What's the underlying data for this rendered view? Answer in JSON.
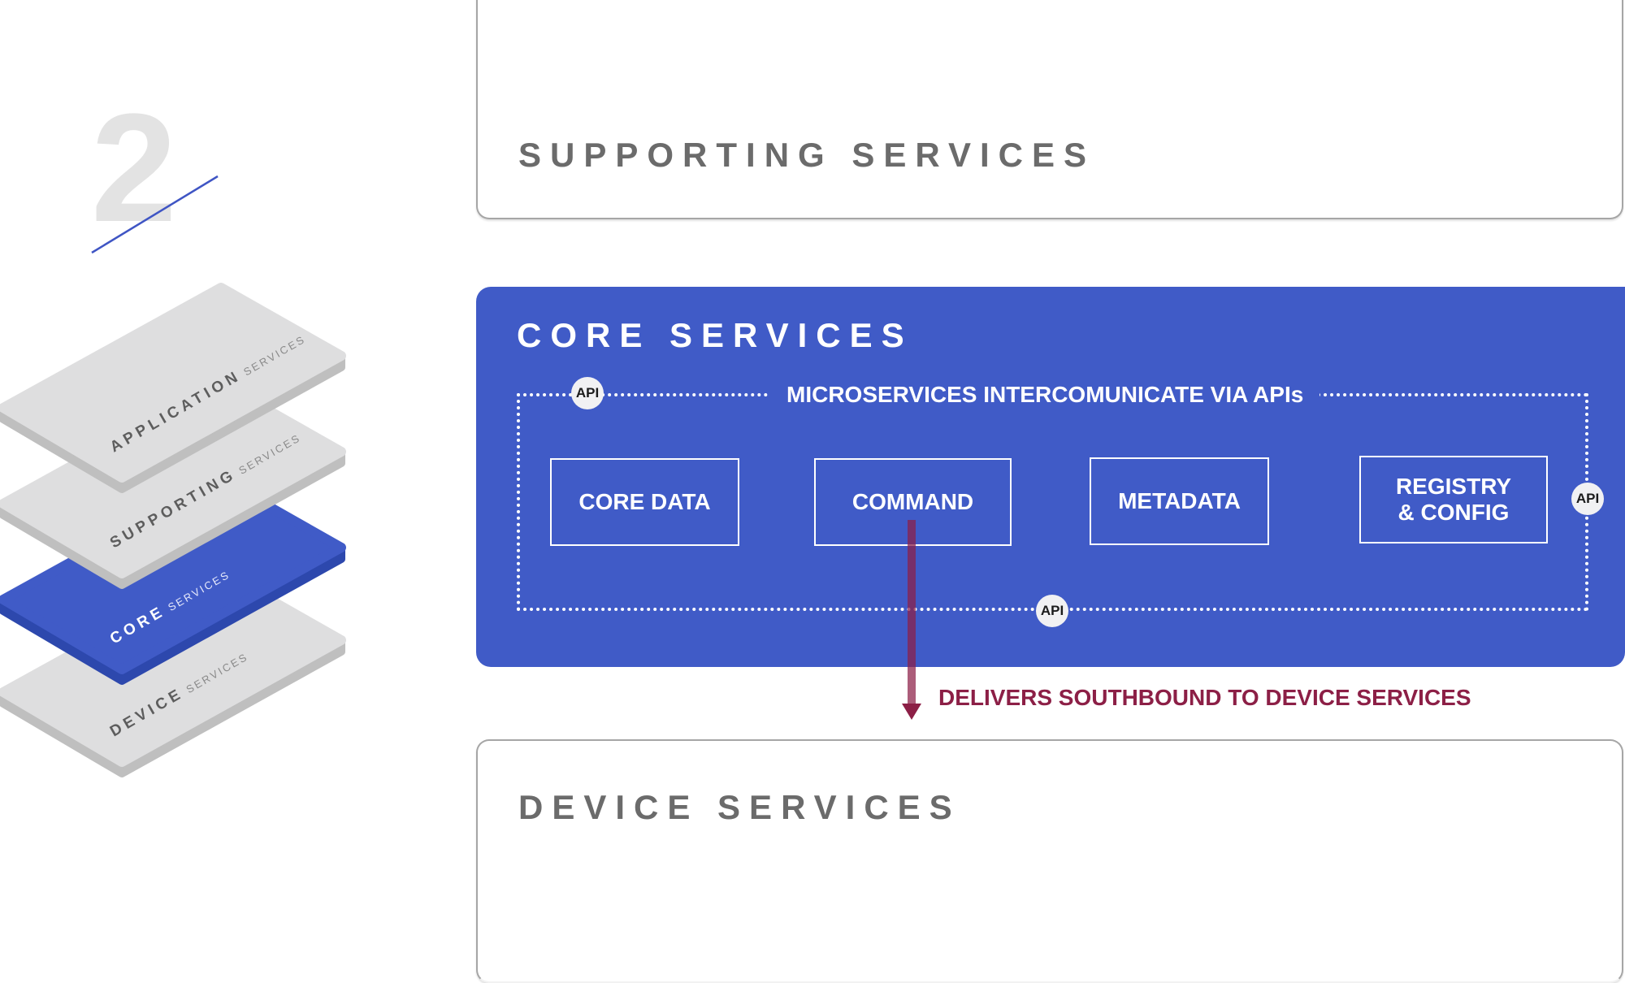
{
  "step": {
    "number": "2"
  },
  "colors": {
    "core_blue": "#405bc7",
    "core_blue_dark": "#2d48ad",
    "card_gray": "#dededf",
    "card_edge": "#bfbfbf",
    "title_gray": "#6b6b6b",
    "accent_maroon": "#8c1f46",
    "step_line": "#3f55c4"
  },
  "stack": {
    "layers": [
      {
        "bold": "APPLICATION",
        "light": "SERVICES",
        "highlighted": false
      },
      {
        "bold": "SUPPORTING",
        "light": "SERVICES",
        "highlighted": false
      },
      {
        "bold": "CORE",
        "light": "SERVICES",
        "highlighted": true
      },
      {
        "bold": "DEVICE",
        "light": "SERVICES",
        "highlighted": false
      }
    ]
  },
  "supporting": {
    "title": "SUPPORTING SERVICES"
  },
  "core": {
    "title": "CORE SERVICES",
    "interconnect_label": "MICROSERVICES INTERCOMUNICATE VIA APIs",
    "api_badge": "API",
    "services": [
      "CORE DATA",
      "COMMAND",
      "METADATA",
      "REGISTRY\n& CONFIG"
    ]
  },
  "southbound": {
    "label": "DELIVERS SOUTHBOUND TO DEVICE SERVICES"
  },
  "device": {
    "title": "DEVICE SERVICES"
  }
}
